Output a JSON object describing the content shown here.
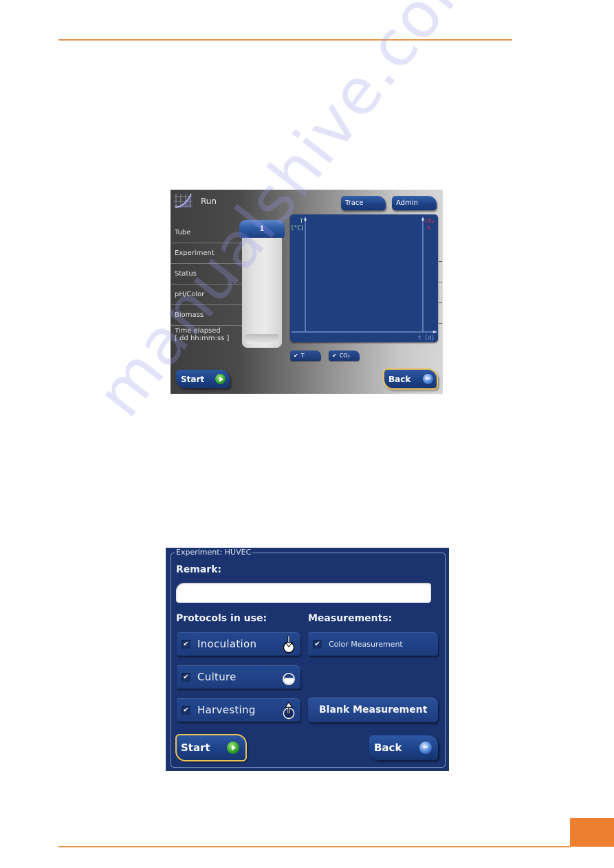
{
  "page": {
    "accent_color": "#ee7f30",
    "watermark": "manualshive.com"
  },
  "run_screen": {
    "title": "Run",
    "icon": "chart-curve-icon",
    "fields": [
      {
        "label": "Tube"
      },
      {
        "label": "Experiment"
      },
      {
        "label": "Status"
      },
      {
        "label": "pH/Color"
      },
      {
        "label": "Biomass"
      },
      {
        "label_line1": "Time elapsed",
        "label_line2": "[ dd hh:mm:ss ]"
      }
    ],
    "tube": {
      "number": "1",
      "cap_color": "#2f5ba5"
    },
    "top_buttons": {
      "trace": "Trace",
      "admin": "Admin"
    },
    "chart": {
      "y_left_label_line1": "T",
      "y_left_label_line2": "[°C]",
      "y_right_label_line1": "CO₂",
      "y_right_label_line2": "%",
      "x_label": "t [d]",
      "left_label_color": "#c6e8a8",
      "right_label_color": "#e0304a",
      "background": "#1f3f7e"
    },
    "series_toggles": [
      {
        "label": "T",
        "checked": true,
        "check_glyph": "✔"
      },
      {
        "label": "CO₂",
        "checked": true,
        "check_glyph": "✔"
      }
    ],
    "start_button": {
      "label": "Start",
      "icon": "play-icon"
    },
    "back_button": {
      "label": "Back",
      "icon": "back-arrow-icon",
      "focused": true
    }
  },
  "chart_data": {
    "type": "line",
    "title": "",
    "xlabel": "t [d]",
    "ylabel": "T [°C]",
    "y2label": "CO₂ %",
    "series": [
      {
        "name": "T",
        "values": []
      },
      {
        "name": "CO₂",
        "values": []
      }
    ],
    "legend": "bottom-left",
    "grid": false
  },
  "experiment_screen": {
    "group_title": "Experiment: HUVEC",
    "remark_label": "Remark:",
    "remark_value": "",
    "protocols_label": "Protocols in use:",
    "measurements_label": "Measurements:",
    "protocols": [
      {
        "label": "Inoculation",
        "checked": true,
        "check_glyph": "✔",
        "icon": "inoculation-icon"
      },
      {
        "label": "Culture",
        "checked": true,
        "check_glyph": "✔",
        "icon": "culture-icon"
      },
      {
        "label": "Harvesting",
        "checked": true,
        "check_glyph": "✔",
        "icon": "harvesting-icon"
      }
    ],
    "measurements": [
      {
        "label": "Color Measurement",
        "checked": true,
        "check_glyph": "✔"
      }
    ],
    "blank_button": "Blank Measurement",
    "start_button": {
      "label": "Start",
      "icon": "play-icon",
      "focused": true
    },
    "back_button": {
      "label": "Back",
      "icon": "back-arrow-icon"
    }
  }
}
